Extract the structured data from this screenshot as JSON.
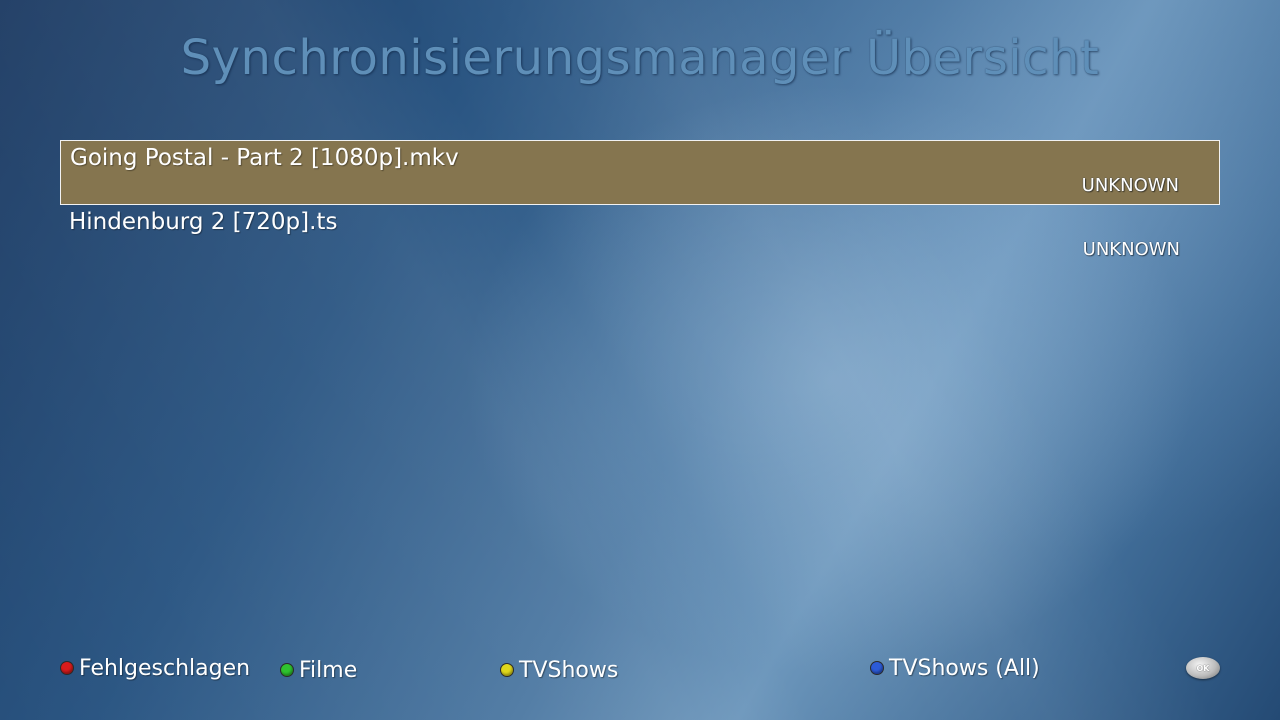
{
  "header": {
    "title": "Synchronisierungsmanager Übersicht"
  },
  "list": {
    "items": [
      {
        "name": "Going Postal - Part 2 [1080p].mkv",
        "status": "UNKNOWN",
        "selected": true
      },
      {
        "name": "Hindenburg 2 [720p].ts",
        "status": "UNKNOWN",
        "selected": false
      }
    ]
  },
  "footer": {
    "red": {
      "label": "Fehlgeschlagen",
      "icon": "red-button-icon",
      "color": "#d81c1c"
    },
    "green": {
      "label": "Filme",
      "icon": "green-button-icon",
      "color": "#2fc32f"
    },
    "yellow": {
      "label": "TVShows",
      "icon": "yellow-button-icon",
      "color": "#e0d81c"
    },
    "blue": {
      "label": "TVShows (All)",
      "icon": "blue-button-icon",
      "color": "#2c5bd8"
    },
    "ok": {
      "label": "OK",
      "icon": "ok-button-icon"
    }
  },
  "colors": {
    "selected_row": "#85754f",
    "title": "#5f8fb8"
  }
}
